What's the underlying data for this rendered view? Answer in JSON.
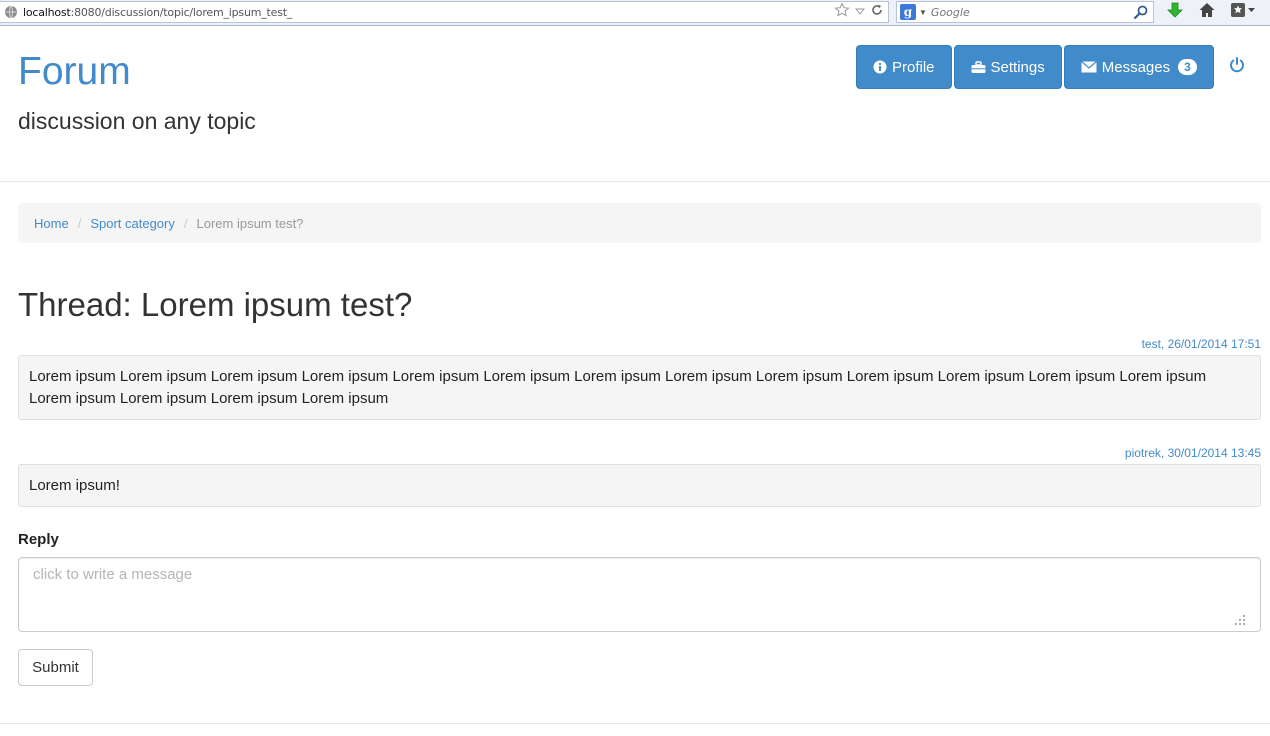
{
  "browser": {
    "url_host": "localhost",
    "url_rest": ":8080/discussion/topic/lorem_ipsum_test_",
    "search_engine": "Google"
  },
  "header": {
    "title": "Forum",
    "subtitle": "discussion on any topic"
  },
  "nav": {
    "profile_label": "Profile",
    "settings_label": "Settings",
    "messages_label": "Messages",
    "messages_count": "3"
  },
  "breadcrumb": {
    "items": [
      "Home",
      "Sport category",
      "Lorem ipsum test?"
    ],
    "separator": "/"
  },
  "thread": {
    "title": "Thread: Lorem ipsum test?",
    "posts": [
      {
        "meta": "test, 26/01/2014 17:51",
        "body": "Lorem ipsum Lorem ipsum Lorem ipsum Lorem ipsum Lorem ipsum Lorem ipsum Lorem ipsum Lorem ipsum Lorem ipsum Lorem ipsum Lorem ipsum Lorem ipsum Lorem ipsum Lorem ipsum Lorem ipsum Lorem ipsum Lorem ipsum"
      },
      {
        "meta": "piotrek, 30/01/2014 13:45",
        "body": "Lorem ipsum!"
      }
    ]
  },
  "reply": {
    "label": "Reply",
    "placeholder": "click to write a message",
    "value": "",
    "submit_label": "Submit"
  },
  "colors": {
    "accent": "#428bca",
    "panel": "#f5f5f5"
  },
  "icons": [
    "globe-icon",
    "bookmark-star-icon",
    "history-dropdown-icon",
    "reload-icon",
    "google-logo-icon",
    "search-icon",
    "download-arrow-icon",
    "home-icon",
    "bookmarks-menu-icon",
    "info-icon",
    "briefcase-icon",
    "envelope-icon",
    "power-icon",
    "resize-grip-icon"
  ]
}
